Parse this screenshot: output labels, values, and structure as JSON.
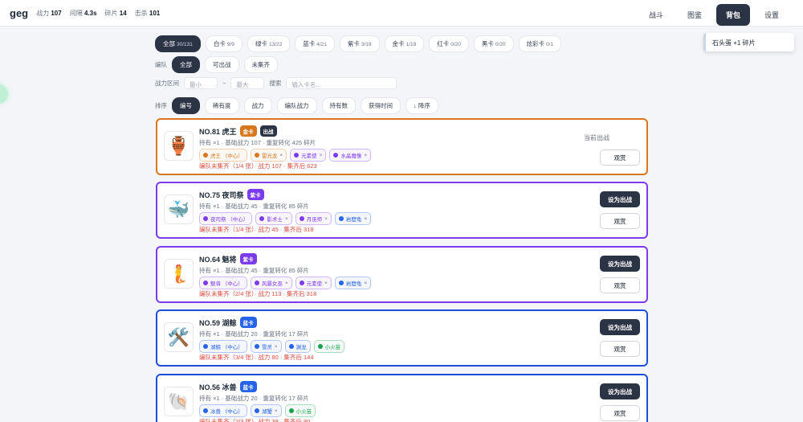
{
  "topbar": {
    "brand": "geg",
    "stats": [
      {
        "label": "战力",
        "value": "107"
      },
      {
        "label": "间隔",
        "value": "4.3s"
      },
      {
        "label": "碎片",
        "value": "14"
      },
      {
        "label": "击杀",
        "value": "101"
      }
    ],
    "nav": [
      {
        "label": "战斗",
        "active": false
      },
      {
        "label": "图鉴",
        "active": false
      },
      {
        "label": "背包",
        "active": true
      },
      {
        "label": "设置",
        "active": false
      }
    ]
  },
  "toast": "石头蛋 +1 碎片",
  "rarity_filters": [
    {
      "label": "全部",
      "count": "30/131",
      "active": true
    },
    {
      "label": "白卡",
      "count": "9/9",
      "active": false
    },
    {
      "label": "绿卡",
      "count": "13/22",
      "active": false
    },
    {
      "label": "蓝卡",
      "count": "4/21",
      "active": false
    },
    {
      "label": "紫卡",
      "count": "3/19",
      "active": false
    },
    {
      "label": "金卡",
      "count": "1/19",
      "active": false
    },
    {
      "label": "红卡",
      "count": "0/20",
      "active": false
    },
    {
      "label": "黑卡",
      "count": "0/20",
      "active": false
    },
    {
      "label": "炫彩卡",
      "count": "0/1",
      "active": false
    }
  ],
  "team_filter": {
    "label": "编队",
    "options": [
      {
        "label": "全部",
        "active": true
      },
      {
        "label": "可出战",
        "active": false
      },
      {
        "label": "未集齐",
        "active": false
      }
    ]
  },
  "power_filter": {
    "label": "战力区间",
    "min_placeholder": "最小",
    "separator": "~",
    "max_placeholder": "最大",
    "search_label": "搜索",
    "search_placeholder": "输入卡名..."
  },
  "sort": {
    "label": "排序",
    "options": [
      {
        "label": "编号",
        "active": true
      },
      {
        "label": "稀有度",
        "active": false
      },
      {
        "label": "战力",
        "active": false
      },
      {
        "label": "编队战力",
        "active": false
      },
      {
        "label": "持有数",
        "active": false
      },
      {
        "label": "获得时间",
        "active": false
      },
      {
        "label": "↓ 降序",
        "active": false
      }
    ]
  },
  "colors": {
    "gold": "#d8771e",
    "purple": "#7c3aed",
    "blue": "#1d4ed8",
    "red_text": "#dc4c3f",
    "dark": "#2b3445"
  },
  "cards": [
    {
      "title": "NO.81 虎王",
      "emoji": "🏺",
      "rarity": "金卡",
      "rarity_color": "#d8771e",
      "extra_badge": "出战",
      "meta": "持有 ×1 · 基础战力 107 · 重复转化 425 碎片",
      "tags": [
        {
          "text": "虎王 （中心）",
          "color": "#d8771e",
          "removable": false
        },
        {
          "text": "雷光龙",
          "color": "#d8771e",
          "removable": true
        },
        {
          "text": "元素使",
          "color": "#7c3aed",
          "removable": true
        },
        {
          "text": "水晶魔像",
          "color": "#7c3aed",
          "removable": true
        }
      ],
      "summary": "编队未集齐（1/4 张）· 战力 107 · 集齐后 623",
      "current_label": "当前出战",
      "primary_label": "",
      "view_label": "观赏"
    },
    {
      "title": "NO.75 夜司祭",
      "emoji": "🐳",
      "rarity": "紫卡",
      "rarity_color": "#7c3aed",
      "extra_badge": "",
      "meta": "持有 ×1 · 基础战力 45 · 重复转化 85 碎片",
      "tags": [
        {
          "text": "夜司祭 （中心）",
          "color": "#7c3aed",
          "removable": false
        },
        {
          "text": "影术士",
          "color": "#7c3aed",
          "removable": true
        },
        {
          "text": "月巫师",
          "color": "#7c3aed",
          "removable": true
        },
        {
          "text": "岩窟龟",
          "color": "#2563eb",
          "removable": true
        }
      ],
      "summary": "编队未集齐（1/4 张）· 战力 45 · 集齐后 318",
      "current_label": "",
      "primary_label": "设为出战",
      "view_label": "观赏"
    },
    {
      "title": "NO.64 魅将",
      "emoji": "🧜",
      "rarity": "紫卡",
      "rarity_color": "#7c3aed",
      "extra_badge": "",
      "meta": "持有 ×1 · 基础战力 45 · 重复转化 85 碎片",
      "tags": [
        {
          "text": "魅将 （中心）",
          "color": "#7c3aed",
          "removable": false
        },
        {
          "text": "风暴女巫",
          "color": "#7c3aed",
          "removable": true
        },
        {
          "text": "元素使",
          "color": "#7c3aed",
          "removable": true
        },
        {
          "text": "岩窟龟",
          "color": "#2563eb",
          "removable": true
        }
      ],
      "summary": "编队未集齐（2/4 张）· 战力 113 · 集齐后 318",
      "current_label": "",
      "primary_label": "设为出战",
      "view_label": "观赏"
    },
    {
      "title": "NO.59 湖鲸",
      "emoji": "🛠️",
      "rarity": "蓝卡",
      "rarity_color": "#2563eb",
      "extra_badge": "",
      "meta": "持有 ×1 · 基础战力 20 · 重复转化 17 碎片",
      "tags": [
        {
          "text": "湖鲸 （中心）",
          "color": "#2563eb",
          "removable": false
        },
        {
          "text": "雪灵",
          "color": "#2563eb",
          "removable": true
        },
        {
          "text": "渊龙",
          "color": "#2563eb",
          "removable": false
        },
        {
          "text": "小火苗",
          "color": "#16a34a",
          "removable": false
        }
      ],
      "summary": "编队未集齐（3/4 张）· 战力 80 · 集齐后 144",
      "current_label": "",
      "primary_label": "设为出战",
      "view_label": "观赏"
    },
    {
      "title": "NO.56 冰兽",
      "emoji": "🐚",
      "rarity": "蓝卡",
      "rarity_color": "#2563eb",
      "extra_badge": "",
      "meta": "持有 ×1 · 基础战力 20 · 重复转化 17 碎片",
      "tags": [
        {
          "text": "冰兽 （中心）",
          "color": "#2563eb",
          "removable": false
        },
        {
          "text": "湖蟹",
          "color": "#2563eb",
          "removable": true
        },
        {
          "text": "小火苗",
          "color": "#16a34a",
          "removable": false
        }
      ],
      "summary": "编队未集齐（2/3 张）· 战力 38 · 集齐后 80",
      "current_label": "",
      "primary_label": "设为出战",
      "view_label": "观赏"
    }
  ]
}
